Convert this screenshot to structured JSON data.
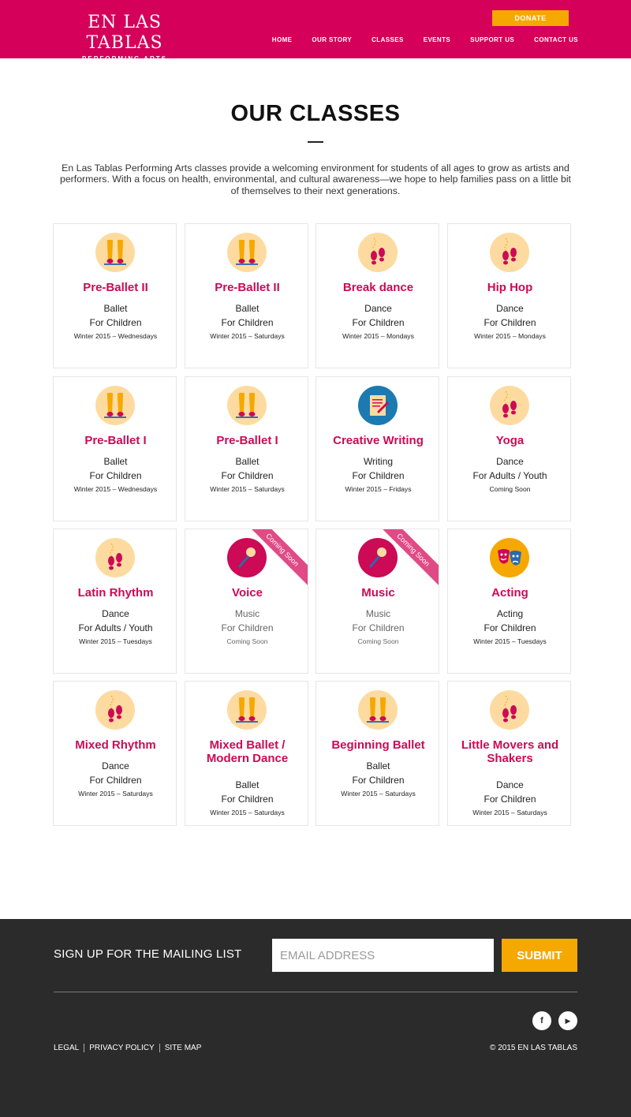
{
  "brand": {
    "title": "EN LAS TABLAS",
    "subtitle": "PERFORMING ARTS",
    "color": "#d4005a",
    "accent": "#f5a800"
  },
  "header": {
    "donate_label": "DONATE",
    "nav": [
      "HOME",
      "OUR STORY",
      "CLASSES",
      "EVENTS",
      "SUPPORT US",
      "CONTACT US"
    ]
  },
  "main": {
    "title": "OUR CLASSES",
    "intro": "En Las Tablas Performing Arts classes provide a welcoming environment for students of all ages to grow as artists and performers. With a focus on health, environmental, and cultural awareness—we hope to help families pass on a little bit of themselves to their next generations."
  },
  "classes": [
    {
      "name": "Pre-Ballet II",
      "category": "Ballet",
      "audience": "For Children",
      "schedule": "Winter 2015 – Wednesdays",
      "icon": "ballet-slippers-icon"
    },
    {
      "name": "Pre-Ballet II",
      "category": "Ballet",
      "audience": "For Children",
      "schedule": "Winter 2015 – Saturdays",
      "icon": "ballet-slippers-icon"
    },
    {
      "name": "Break dance",
      "category": "Dance",
      "audience": "For Children",
      "schedule": "Winter 2015 – Mondays",
      "icon": "dance-steps-icon"
    },
    {
      "name": "Hip Hop",
      "category": "Dance",
      "audience": "For Children",
      "schedule": "Winter 2015 – Mondays",
      "icon": "dance-steps-icon"
    },
    {
      "name": "Pre-Ballet I",
      "category": "Ballet",
      "audience": "For Children",
      "schedule": "Winter 2015 – Wednesdays",
      "icon": "ballet-slippers-icon"
    },
    {
      "name": "Pre-Ballet I",
      "category": "Ballet",
      "audience": "For Children",
      "schedule": "Winter 2015 – Saturdays",
      "icon": "ballet-slippers-icon"
    },
    {
      "name": "Creative Writing",
      "category": "Writing",
      "audience": "For Children",
      "schedule": "Winter 2015 – Fridays",
      "icon": "writing-pad-icon"
    },
    {
      "name": "Yoga",
      "category": "Dance",
      "audience": "For Adults / Youth",
      "schedule": "Coming Soon",
      "icon": "dance-steps-icon"
    },
    {
      "name": "Latin Rhythm",
      "category": "Dance",
      "audience": "For Adults / Youth",
      "schedule": "Winter 2015 – Tuesdays",
      "icon": "dance-steps-icon"
    },
    {
      "name": "Voice",
      "category": "Music",
      "audience": "For Children",
      "schedule": "Coming Soon",
      "icon": "microphone-icon",
      "ribbon": "Coming Soon"
    },
    {
      "name": "Music",
      "category": "Music",
      "audience": "For Children",
      "schedule": "Coming Soon",
      "icon": "microphone-icon",
      "ribbon": "Coming Soon"
    },
    {
      "name": "Acting",
      "category": "Acting",
      "audience": "For Children",
      "schedule": "Winter 2015 – Tuesdays",
      "icon": "theater-masks-icon"
    },
    {
      "name": "Mixed Rhythm",
      "category": "Dance",
      "audience": "For Children",
      "schedule": "Winter 2015 – Saturdays",
      "icon": "dance-steps-icon"
    },
    {
      "name": "Mixed Ballet / Modern Dance",
      "category": "Ballet",
      "audience": "For Children",
      "schedule": "Winter 2015 – Saturdays",
      "icon": "ballet-slippers-icon"
    },
    {
      "name": "Beginning Ballet",
      "category": "Ballet",
      "audience": "For Children",
      "schedule": "Winter 2015 – Saturdays",
      "icon": "ballet-slippers-icon"
    },
    {
      "name": "Little Movers and Shakers",
      "category": "Dance",
      "audience": "For Children",
      "schedule": "Winter 2015 – Saturdays",
      "icon": "dance-steps-icon"
    }
  ],
  "footer": {
    "mailing_label": "SIGN UP FOR THE MAILING LIST",
    "email_placeholder": "EMAIL ADDRESS",
    "submit_label": "SUBMIT",
    "social": [
      {
        "icon": "facebook-icon",
        "glyph": "f"
      },
      {
        "icon": "youtube-icon",
        "glyph": "▶"
      }
    ],
    "links": [
      "LEGAL",
      "PRIVACY POLICY",
      "SITE MAP"
    ],
    "copyright": "© 2015 EN LAS TABLAS"
  }
}
